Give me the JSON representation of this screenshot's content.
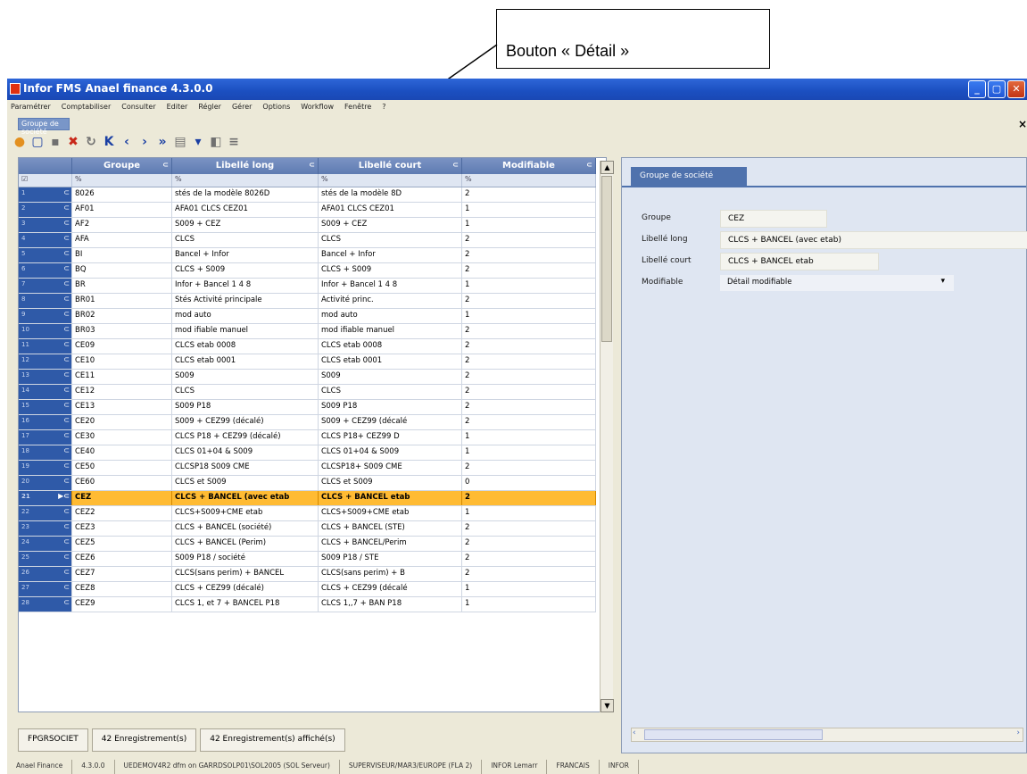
{
  "callout": {
    "text": "Bouton « Détail »"
  },
  "window": {
    "title": "Infor FMS Anael finance 4.3.0.0",
    "buttons": {
      "min": "_",
      "max": "▢",
      "close": "✕"
    }
  },
  "menu": [
    "Paramétrer",
    "Comptabiliser",
    "Consulter",
    "Editer",
    "Régler",
    "Gérer",
    "Options",
    "Workflow",
    "Fenêtre",
    "?"
  ],
  "doc_tab": {
    "label": "Groupe de société",
    "close": "×"
  },
  "toolbar_icons": [
    "start-icon",
    "new-icon",
    "save-icon",
    "delete-icon",
    "refresh-icon",
    "first-icon",
    "prev-icon",
    "next-icon",
    "last-icon",
    "print-icon",
    "filter-icon",
    "export-icon",
    "detail-icon"
  ],
  "grid": {
    "columns": [
      "Groupe",
      "Libellé long",
      "Libellé court",
      "Modifiable"
    ],
    "filter_mark": "%",
    "rows": [
      {
        "n": "1",
        "groupe": "8026",
        "long": "stés de la modèle 8026D",
        "court": "stés de la modèle 8D",
        "mod": "2"
      },
      {
        "n": "2",
        "groupe": "AF01",
        "long": "AFA01 CLCS CEZ01",
        "court": "AFA01 CLCS CEZ01",
        "mod": "1"
      },
      {
        "n": "3",
        "groupe": "AF2",
        "long": "S009 + CEZ",
        "court": "S009 + CEZ",
        "mod": "1"
      },
      {
        "n": "4",
        "groupe": "AFA",
        "long": "CLCS",
        "court": "CLCS",
        "mod": "2"
      },
      {
        "n": "5",
        "groupe": "BI",
        "long": "Bancel + Infor",
        "court": "Bancel + Infor",
        "mod": "2"
      },
      {
        "n": "6",
        "groupe": "BQ",
        "long": "CLCS + S009",
        "court": "CLCS + S009",
        "mod": "2"
      },
      {
        "n": "7",
        "groupe": "BR",
        "long": "Infor + Bancel 1 4 8",
        "court": "Infor + Bancel 1 4 8",
        "mod": "1"
      },
      {
        "n": "8",
        "groupe": "BR01",
        "long": "Stés Activité principale",
        "court": "Activité princ.",
        "mod": "2"
      },
      {
        "n": "9",
        "groupe": "BR02",
        "long": "mod auto",
        "court": "mod auto",
        "mod": "1"
      },
      {
        "n": "10",
        "groupe": "BR03",
        "long": "mod ifiable manuel",
        "court": "mod ifiable manuel",
        "mod": "2"
      },
      {
        "n": "11",
        "groupe": "CE09",
        "long": "CLCS etab 0008",
        "court": "CLCS etab 0008",
        "mod": "2"
      },
      {
        "n": "12",
        "groupe": "CE10",
        "long": "CLCS etab 0001",
        "court": "CLCS etab 0001",
        "mod": "2"
      },
      {
        "n": "13",
        "groupe": "CE11",
        "long": "S009",
        "court": "S009",
        "mod": "2"
      },
      {
        "n": "14",
        "groupe": "CE12",
        "long": "CLCS",
        "court": "CLCS",
        "mod": "2"
      },
      {
        "n": "15",
        "groupe": "CE13",
        "long": "S009 P18",
        "court": "S009 P18",
        "mod": "2"
      },
      {
        "n": "16",
        "groupe": "CE20",
        "long": "S009 + CEZ99 (décalé)",
        "court": "S009 + CEZ99 (décalé",
        "mod": "2"
      },
      {
        "n": "17",
        "groupe": "CE30",
        "long": "CLCS P18 + CEZ99 (décalé)",
        "court": "CLCS P18+ CEZ99 D",
        "mod": "1"
      },
      {
        "n": "18",
        "groupe": "CE40",
        "long": "CLCS 01+04 & S009",
        "court": "CLCS 01+04 & S009",
        "mod": "1"
      },
      {
        "n": "19",
        "groupe": "CE50",
        "long": "CLCSP18 S009 CME",
        "court": "CLCSP18+ S009 CME",
        "mod": "2"
      },
      {
        "n": "20",
        "groupe": "CE60",
        "long": "CLCS et S009",
        "court": "CLCS et S009",
        "mod": "0"
      },
      {
        "n": "21",
        "groupe": "CEZ",
        "long": "CLCS + BANCEL (avec etab",
        "court": "CLCS + BANCEL etab",
        "mod": "2",
        "sel": true
      },
      {
        "n": "22",
        "groupe": "CEZ2",
        "long": "CLCS+S009+CME etab",
        "court": "CLCS+S009+CME etab",
        "mod": "1"
      },
      {
        "n": "23",
        "groupe": "CEZ3",
        "long": "CLCS + BANCEL (société)",
        "court": "CLCS + BANCEL (STE)",
        "mod": "2"
      },
      {
        "n": "24",
        "groupe": "CEZ5",
        "long": "CLCS + BANCEL (Perim)",
        "court": "CLCS + BANCEL/Perim",
        "mod": "2"
      },
      {
        "n": "25",
        "groupe": "CEZ6",
        "long": "S009 P18 / société",
        "court": "S009 P18 / STE",
        "mod": "2"
      },
      {
        "n": "26",
        "groupe": "CEZ7",
        "long": "CLCS(sans perim) + BANCEL",
        "court": "CLCS(sans perim) + B",
        "mod": "2"
      },
      {
        "n": "27",
        "groupe": "CEZ8",
        "long": "CLCS + CEZ99 (décalé)",
        "court": "CLCS + CEZ99 (décalé",
        "mod": "1"
      },
      {
        "n": "28",
        "groupe": "CEZ9",
        "long": "CLCS 1, et 7 + BANCEL P18",
        "court": "CLCS 1,,7 + BAN P18",
        "mod": "1"
      }
    ]
  },
  "grid_status": [
    "FPGRSOCIET",
    "42 Enregistrement(s)",
    "42 Enregistrement(s) affiché(s)"
  ],
  "detail": {
    "tab": "Groupe de société",
    "fields": [
      {
        "label": "Groupe",
        "value": "CEZ"
      },
      {
        "label": "Libellé long",
        "value": "CLCS + BANCEL (avec etab)"
      },
      {
        "label": "Libellé court",
        "value": "CLCS + BANCEL etab"
      }
    ],
    "modifiable": {
      "label": "Modifiable",
      "value": "Détail modifiable"
    }
  },
  "app_status": [
    "Anael Finance",
    "4.3.0.0",
    "UEDEMOV4R2 dfm on GARRDSOLP01\\SOL2005 (SOL Serveur)",
    "SUPERVISEUR/MAR3/EUROPE (FLA 2)",
    "INFOR Lemarr",
    "FRANCAIS",
    "INFOR"
  ]
}
